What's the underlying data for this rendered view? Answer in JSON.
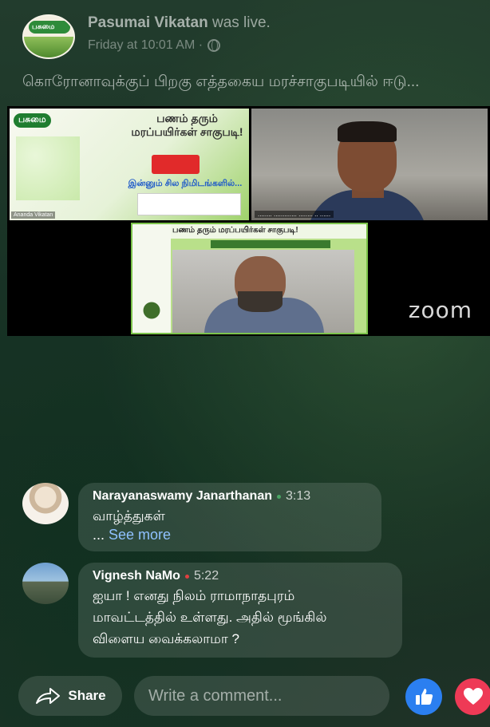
{
  "header": {
    "page_name": "Pasumai Vikatan",
    "status_suffix": "was live.",
    "timestamp": "Friday at 10:01 AM ·"
  },
  "post": {
    "text": "கொரோனாவுக்குப் பிறகு எத்தகைய மரச்சாகுபடியில் ஈடு..."
  },
  "video": {
    "slide1_brand": "பசுமை",
    "slide1_heading": "பணம் தரும் மரப்பயிர்கள் சாகுபடி!",
    "slide1_soon": "இன்னும் சில நிமிடங்களில்...",
    "slide1_watermark": "Ananda Vikatan",
    "slide2_band": "பணம் தரும் மரப்பயிர்கள் சாகுபடி!",
    "zoom_label": "zoom"
  },
  "comments": [
    {
      "author": "Narayanaswamy Janarthanan",
      "time": "3:13",
      "text": "வாழ்த்துகள்",
      "more_prefix": "... ",
      "more_label": "See more"
    },
    {
      "author": "Vignesh NaMo",
      "time": "5:22",
      "lines": [
        "ஐயா ! எனது நிலம் ராமாநாதபுரம்",
        "மாவட்டத்தில் உள்ளது. அதில் மூங்கில்",
        "விளைய வைக்கலாமா ?"
      ]
    }
  ],
  "actions": {
    "share_label": "Share",
    "comment_placeholder": "Write a comment..."
  },
  "colors": {
    "like": "#2b7ff0",
    "love": "#ee3a56",
    "see_more": "#8fc1ff"
  }
}
